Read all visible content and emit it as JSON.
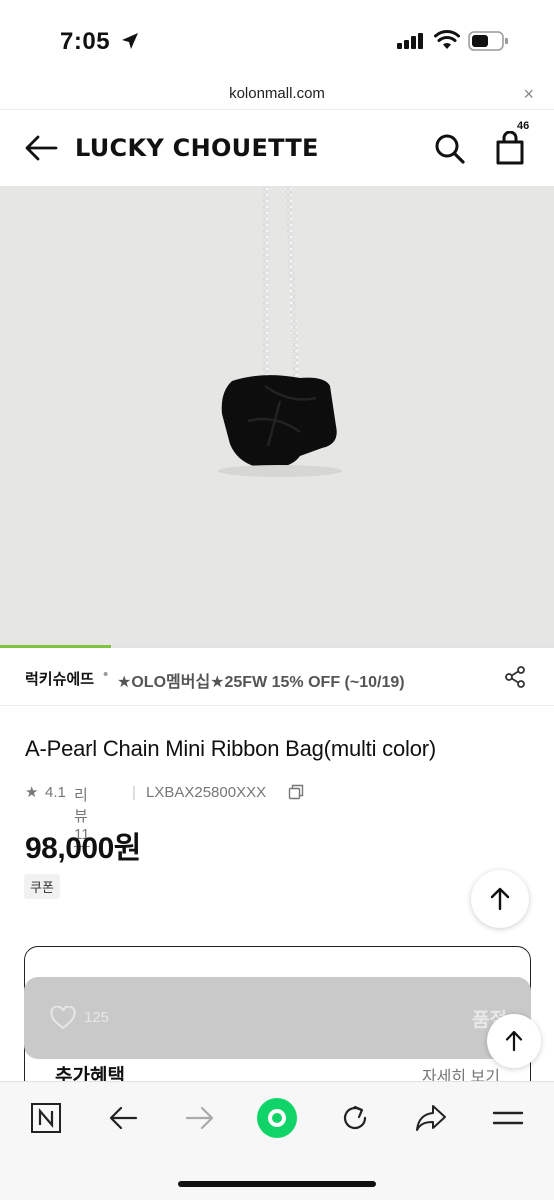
{
  "status_bar": {
    "time": "7:05"
  },
  "browser": {
    "url": "kolonmall.com",
    "close_label": "×"
  },
  "header": {
    "brand": "LUCKY CHOUETTE",
    "cart_count": "46"
  },
  "gallery": {
    "progress": 0.2
  },
  "promo": {
    "store": "럭키슈에뜨",
    "separator": "•",
    "text": "★OLO멤버십★25FW 15% OFF (~10/19)"
  },
  "product": {
    "title": "A-Pearl Chain Mini Ribbon Bag(multi color)",
    "rating_star": "★",
    "rating": "4.1",
    "reviews": "리뷰 11",
    "divider": "|",
    "code": "LXBAX25800XXX",
    "price": "98,000원",
    "coupon": "쿠폰"
  },
  "benefits": {
    "label": "추가혜택",
    "more": "자세히 보기"
  },
  "purchase_bar": {
    "likes": "125",
    "status": "품절"
  },
  "colors": {
    "accent": "#7cc441",
    "toolbar_green": "#10d468"
  }
}
